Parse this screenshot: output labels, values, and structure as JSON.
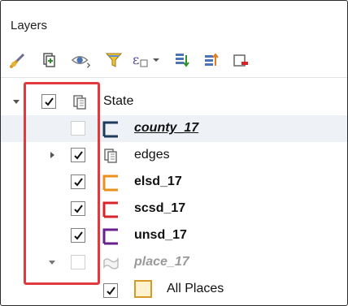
{
  "panel": {
    "title": "Layers"
  },
  "toolbar": {
    "buttons": [
      {
        "name": "style-brush-icon"
      },
      {
        "name": "add-group-icon"
      },
      {
        "name": "manage-map-themes-icon"
      },
      {
        "name": "filter-legend-icon"
      },
      {
        "name": "filter-expression-icon"
      },
      {
        "name": "expand-all-icon"
      },
      {
        "name": "collapse-all-icon"
      },
      {
        "name": "remove-layer-icon"
      }
    ]
  },
  "tree": {
    "group": {
      "label": "State",
      "checked": true
    },
    "layers": [
      {
        "label": "county_17",
        "checked": false,
        "color": "#1e3a5f",
        "style": "active"
      },
      {
        "label": "edges",
        "checked": true,
        "type": "group"
      },
      {
        "label": "elsd_17",
        "checked": true,
        "color": "#e8911b",
        "style": "bold"
      },
      {
        "label": "scsd_17",
        "checked": true,
        "color": "#d8232a",
        "style": "bold"
      },
      {
        "label": "unsd_17",
        "checked": true,
        "color": "#6a1f8f",
        "style": "bold"
      },
      {
        "label": "place_17",
        "checked": false,
        "style": "muted"
      }
    ],
    "legend_item": {
      "label": "All Places",
      "checked": true,
      "fill": "#fff3cf",
      "stroke": "#d69a2c"
    }
  },
  "highlight_color": "#e0393e"
}
